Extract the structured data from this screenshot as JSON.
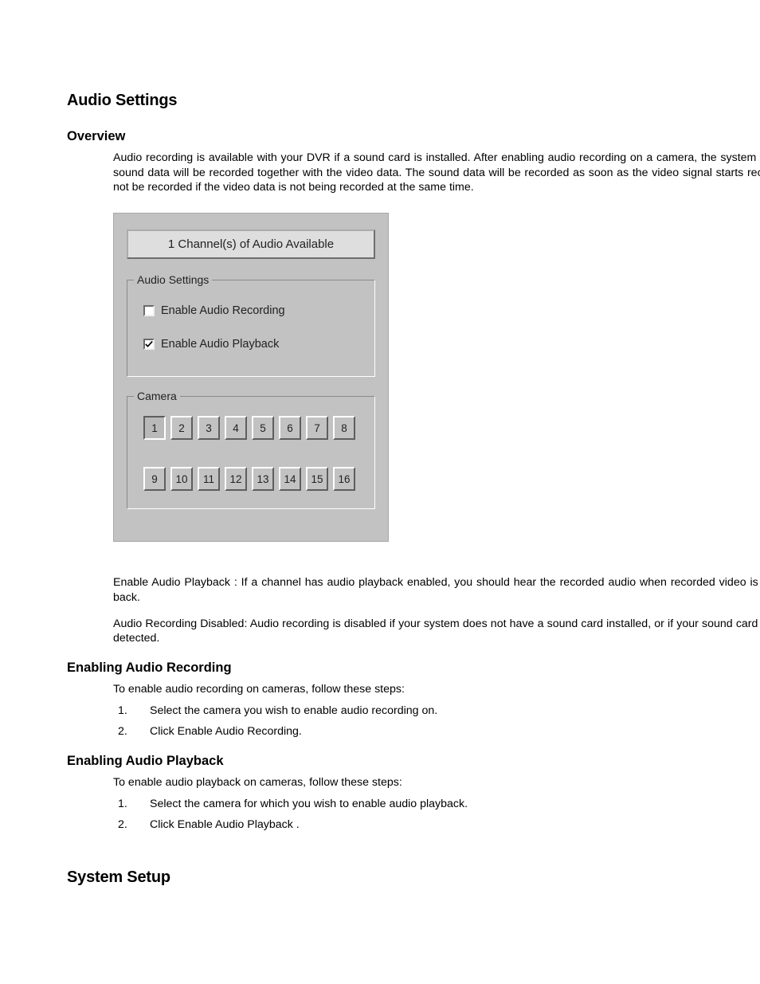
{
  "headings": {
    "audio_settings": "Audio Settings",
    "overview": "Overview",
    "enabling_recording": "Enabling Audio Recording",
    "enabling_playback": "Enabling Audio Playback",
    "system_setup": "System Setup"
  },
  "text": {
    "overview_p1": "Audio recording is available with your DVR if a sound card is installed. After enabling audio recording on a camera, the system microphone's sound data will be recorded together with the video data. The sound data will be recorded as soon as the video signal starts recording. It will not be recorded if the video data is not being recorded at the same time.",
    "playback_note": "Enable Audio Playback : If a channel has audio playback enabled, you should hear the recorded audio when recorded video is being played back.",
    "disabled_note": "Audio Recording Disabled: Audio recording is disabled if your system does not have a sound card installed, or if your sound card has not been detected.",
    "recording_intro": "To enable audio recording on cameras, follow these steps:",
    "playback_intro": "To enable audio playback on cameras, follow these steps:"
  },
  "steps_recording": [
    "Select the camera you wish to enable audio recording on.",
    "Click Enable Audio Recording."
  ],
  "steps_playback": [
    "Select the camera for which you wish to enable audio playback.",
    "Click Enable Audio Playback ."
  ],
  "dialog": {
    "header": "1 Channel(s) of Audio Available",
    "audio_settings_legend": "Audio Settings",
    "camera_legend": "Camera",
    "chk_recording_label": "Enable Audio Recording",
    "chk_recording_checked": false,
    "chk_playback_label": "Enable Audio Playback",
    "chk_playback_checked": true,
    "cameras": [
      "1",
      "2",
      "3",
      "4",
      "5",
      "6",
      "7",
      "8",
      "9",
      "10",
      "11",
      "12",
      "13",
      "14",
      "15",
      "16"
    ],
    "camera_active_index": 0
  }
}
